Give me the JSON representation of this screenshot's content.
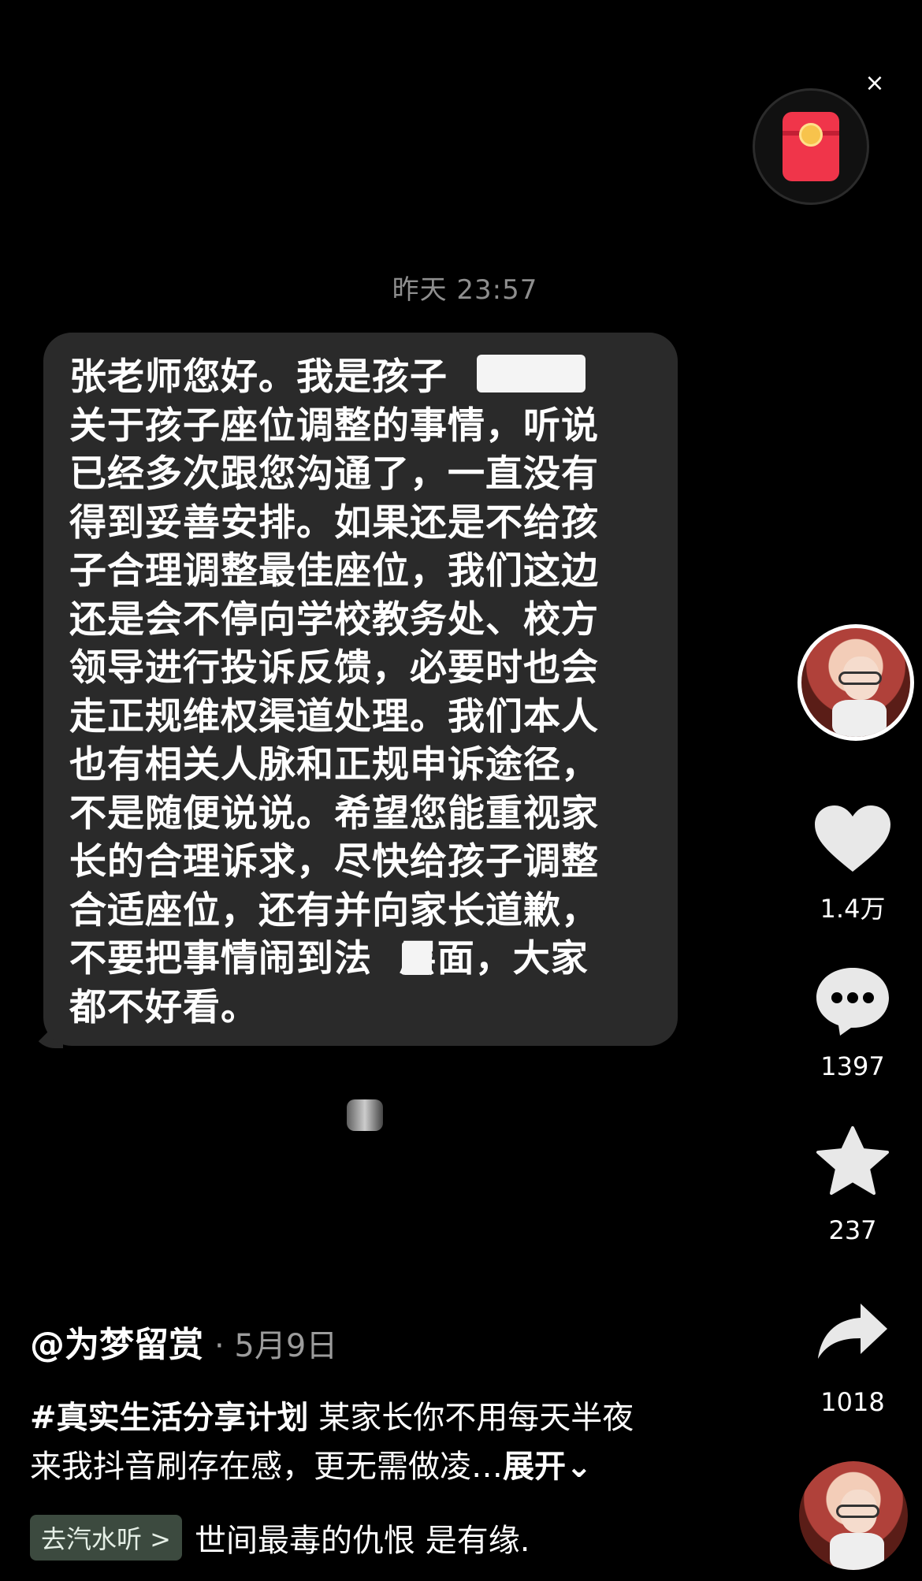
{
  "top": {
    "close_glyph": "×"
  },
  "chat": {
    "timestamp": "昨天 23:57",
    "message": "张老师您好。我是孩子\n关于孩子座位调整的事情，听说\n已经多次跟您沟通了，一直没有\n得到妥善安排。如果还是不给孩\n子合理调整最佳座位，我们这边\n还是会不停向学校教务处、校方\n领导进行投诉反馈，必要时也会\n走正规维权渠道处理。我们本人\n也有相关人脉和正规申诉途径，\n不是随便说说。希望您能重视家\n长的合理诉求，尽快给孩子调整\n合适座位，还有并向家长道歉，\n不要把事情闹到法  层面，大家\n都不好看。"
  },
  "rail": {
    "likes": "1.4万",
    "comments": "1397",
    "favorites": "237",
    "shares": "1018"
  },
  "post": {
    "author": "@为梦留赏",
    "date": "· 5月9日",
    "hashtag": "#真实生活分享计划",
    "text": " 某家长你不用每天半夜\n来我抖音刷存在感，更无需做凌…",
    "expand": "展开⌄",
    "music_pill": "去汽水听 >",
    "music_text": "世间最毒的仇恨 是有缘."
  }
}
